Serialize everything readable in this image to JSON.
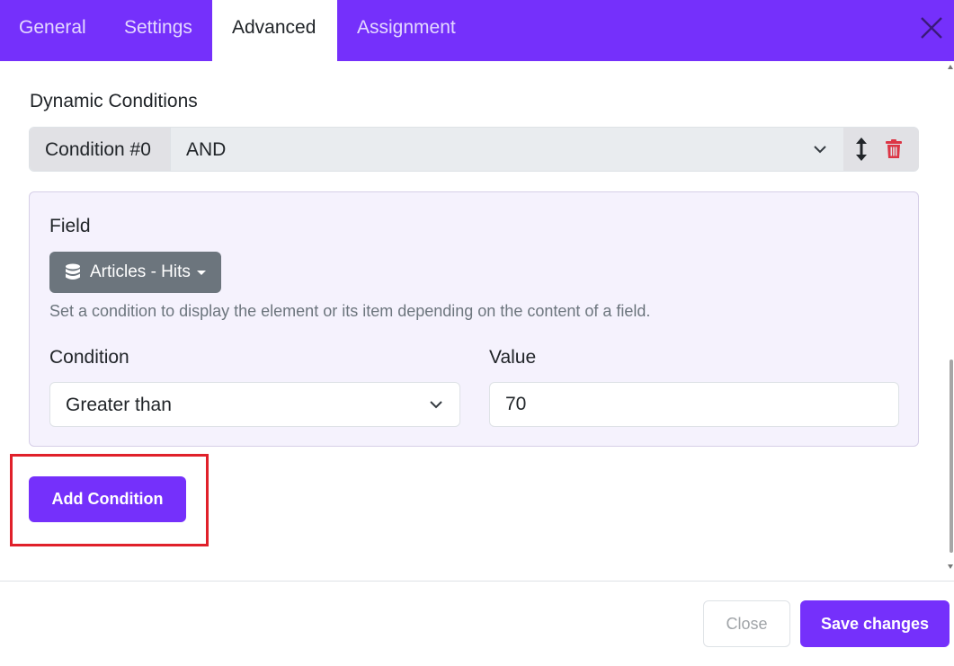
{
  "tabs": [
    {
      "label": "General",
      "active": false
    },
    {
      "label": "Settings",
      "active": false
    },
    {
      "label": "Advanced",
      "active": true
    },
    {
      "label": "Assignment",
      "active": false
    }
  ],
  "section_title": "Dynamic Conditions",
  "condition": {
    "label": "Condition #0",
    "operator": "AND",
    "field_label": "Field",
    "field_button": "Articles - Hits",
    "help_text": "Set a condition to display the element or its item depending on the content of a field.",
    "condition_label": "Condition",
    "condition_value": "Greater than",
    "value_label": "Value",
    "value": "70"
  },
  "add_condition_label": "Add Condition",
  "footer": {
    "close_label": "Close",
    "save_label": "Save changes"
  },
  "icons": {
    "close": "close-icon",
    "move": "move-vertical-icon",
    "trash": "trash-icon",
    "database": "database-icon",
    "chevron": "chevron-down-icon"
  },
  "colors": {
    "accent": "#7530fb",
    "danger": "#dc3545",
    "highlight": "#e0202a",
    "secondary": "#6c757d"
  }
}
